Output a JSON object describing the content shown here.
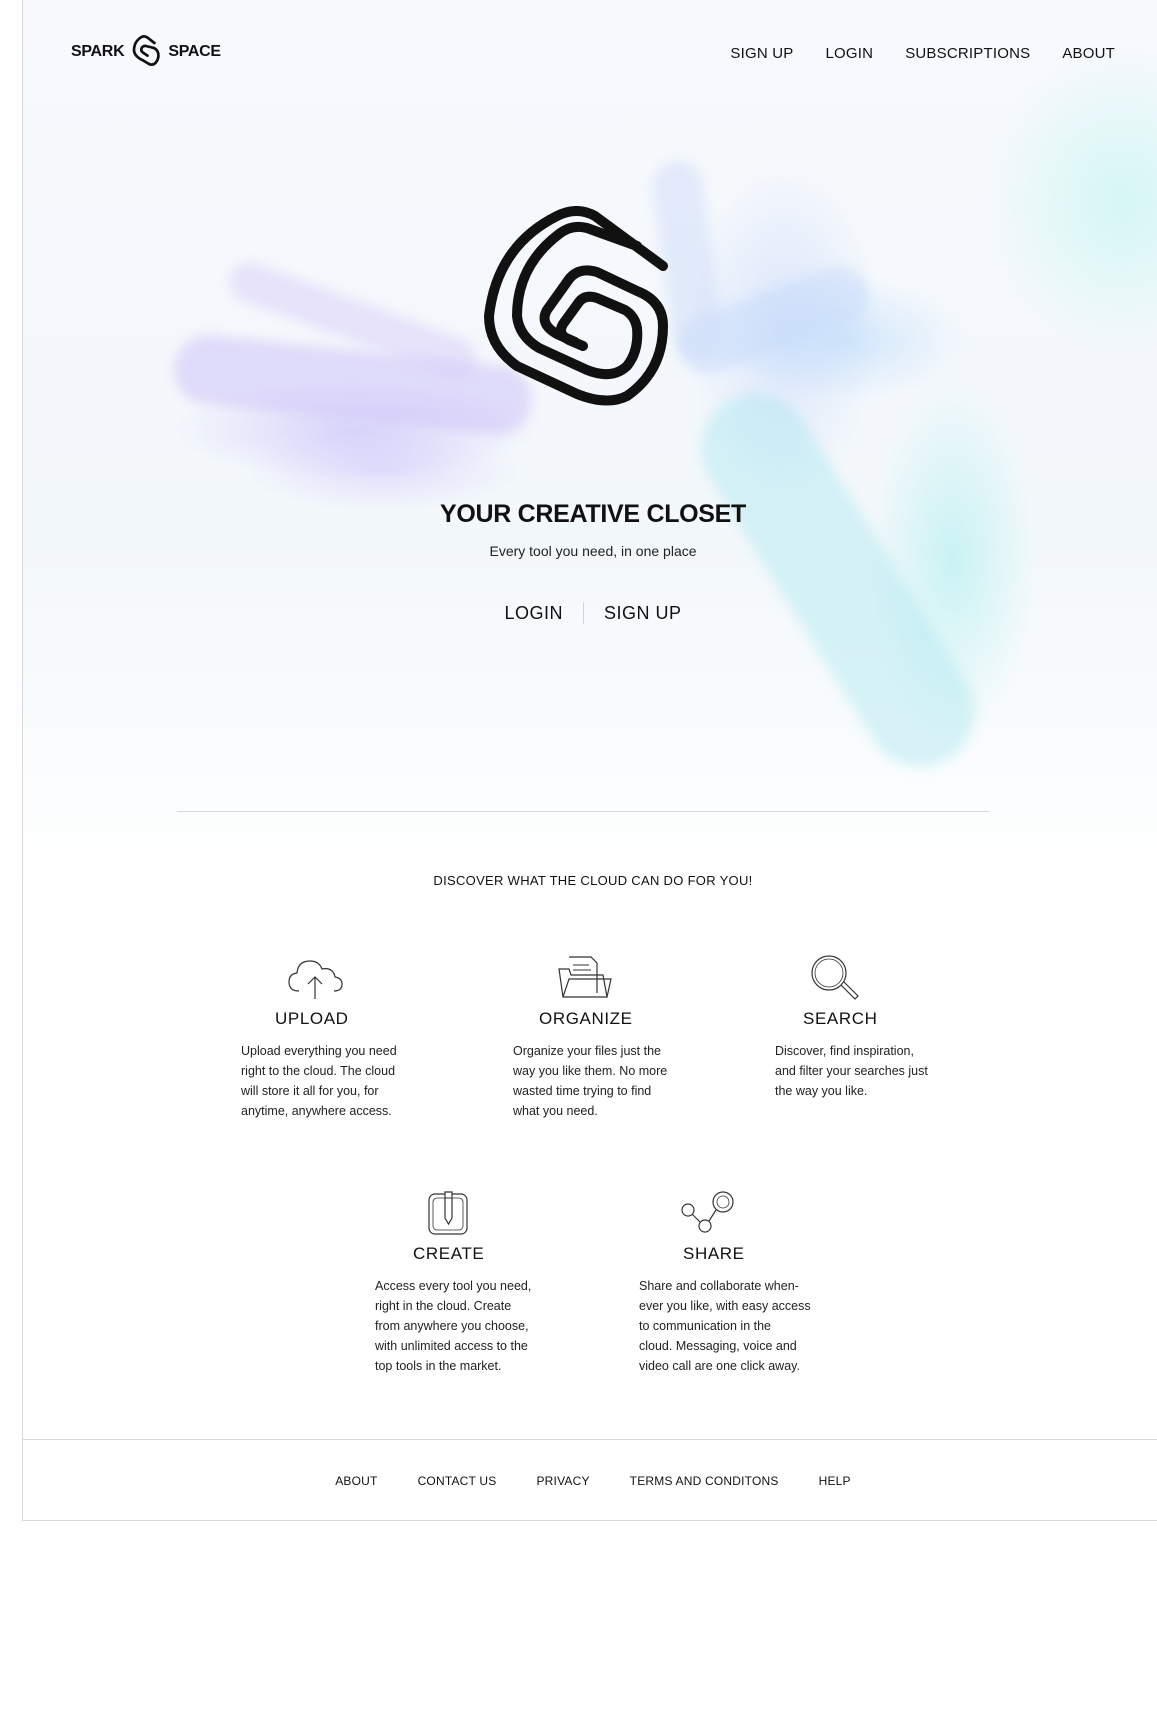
{
  "brand": {
    "left_word": "SPARK",
    "right_word": "SPACE"
  },
  "nav": [
    {
      "label": "SIGN UP"
    },
    {
      "label": "LOGIN"
    },
    {
      "label": "SUBSCRIPTIONS"
    },
    {
      "label": "ABOUT"
    }
  ],
  "hero": {
    "title": "YOUR CREATIVE CLOSET",
    "subtitle": "Every tool you need, in one place",
    "login_label": "LOGIN",
    "signup_label": "SIGN UP"
  },
  "discover": {
    "heading": "DISCOVER WHAT THE CLOUD CAN DO FOR YOU!"
  },
  "features": [
    {
      "icon": "cloud-upload-icon",
      "title": "UPLOAD",
      "lines": [
        "Upload everything you need",
        "right to the cloud. The cloud",
        "will store it all for you, for",
        "anytime, anywhere access."
      ]
    },
    {
      "icon": "folder-icon",
      "title": "ORGANIZE",
      "lines": [
        "Organize your files just the",
        "way you like them. No more",
        "wasted time trying to find",
        "what you need."
      ]
    },
    {
      "icon": "search-icon",
      "title": "SEARCH",
      "lines": [
        "Discover, find inspiration,",
        "and filter your searches just",
        "the way you like."
      ]
    },
    {
      "icon": "pencil-icon",
      "title": "CREATE",
      "lines": [
        "Access every tool you need,",
        "right in the cloud. Create",
        "from anywhere you choose,",
        "with unlimited access to the",
        "top tools in the market."
      ]
    },
    {
      "icon": "share-icon",
      "title": "SHARE",
      "lines": [
        "Share and collaborate when-",
        "ever you like, with easy access",
        "to communication in the",
        "cloud. Messaging, voice and",
        "video call are one click away."
      ]
    }
  ],
  "footer": [
    {
      "label": "ABOUT"
    },
    {
      "label": "CONTACT US"
    },
    {
      "label": "PRIVACY"
    },
    {
      "label": "TERMS AND CONDITONS"
    },
    {
      "label": "HELP"
    }
  ]
}
